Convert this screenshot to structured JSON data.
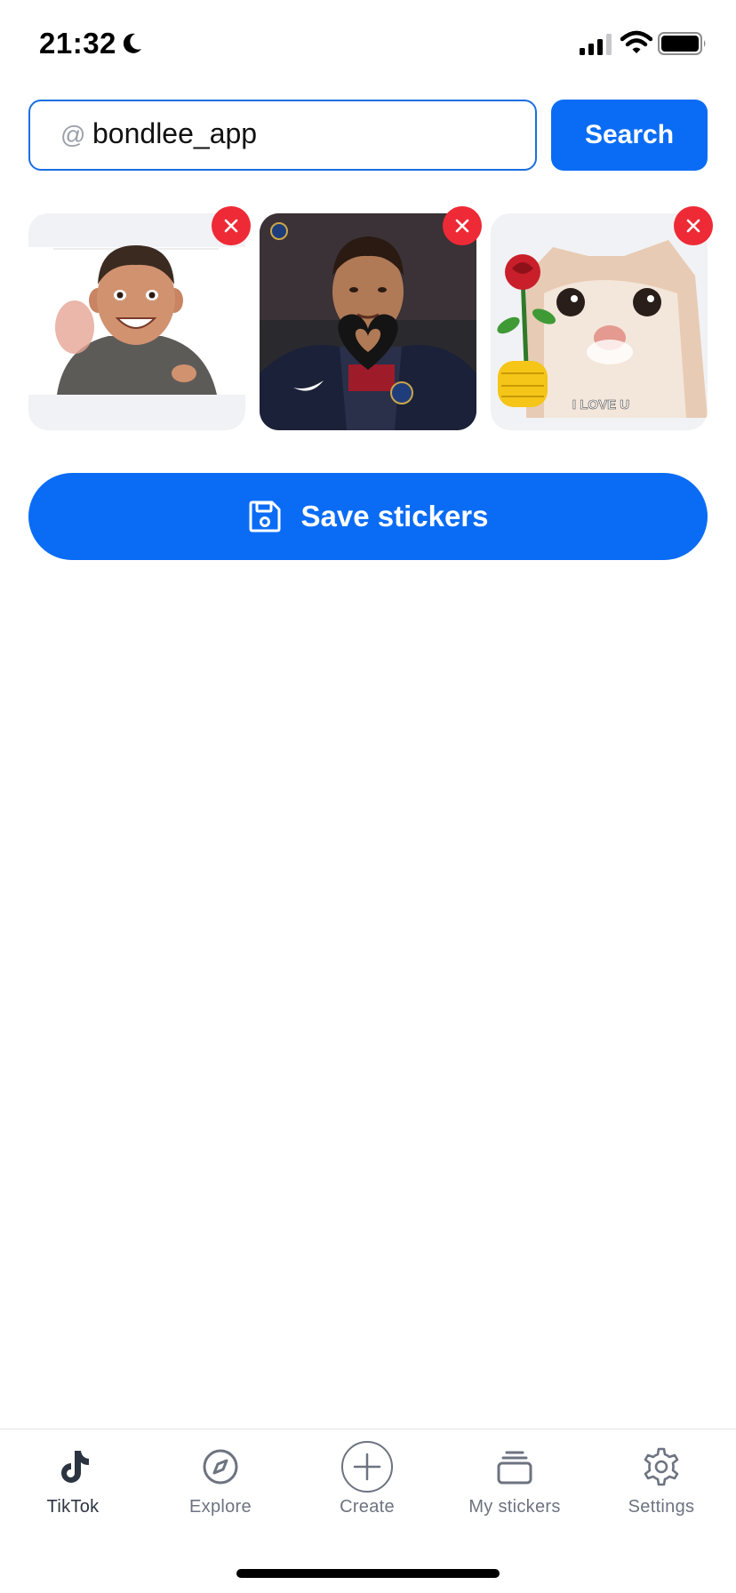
{
  "status_bar": {
    "time": "21:32",
    "icons": [
      "moon-icon",
      "signal-icon",
      "wifi-icon",
      "battery-icon"
    ]
  },
  "search": {
    "at_symbol": "@",
    "value": "bondlee_app",
    "button_label": "Search"
  },
  "stickers": [
    {
      "name": "boy-waving-sticker",
      "remove_icon": "close-icon"
    },
    {
      "name": "football-player-heart-sticker",
      "remove_icon": "close-icon"
    },
    {
      "name": "cat-with-rose-sticker",
      "caption": "I LOVE U",
      "remove_icon": "close-icon"
    }
  ],
  "save": {
    "label": "Save stickers",
    "icon": "floppy-disk-icon"
  },
  "tabs": [
    {
      "label": "TikTok",
      "icon": "tiktok-icon",
      "active": true
    },
    {
      "label": "Explore",
      "icon": "compass-icon",
      "active": false
    },
    {
      "label": "Create",
      "icon": "plus-circle-icon",
      "active": false
    },
    {
      "label": "My stickers",
      "icon": "stack-icon",
      "active": false
    },
    {
      "label": "Settings",
      "icon": "gear-icon",
      "active": false
    }
  ],
  "colors": {
    "accent": "#0a6cf5",
    "remove": "#ee2a36",
    "input_border": "#1a6fe0",
    "tab_inactive": "#6d7380",
    "tab_active": "#2b3440"
  }
}
